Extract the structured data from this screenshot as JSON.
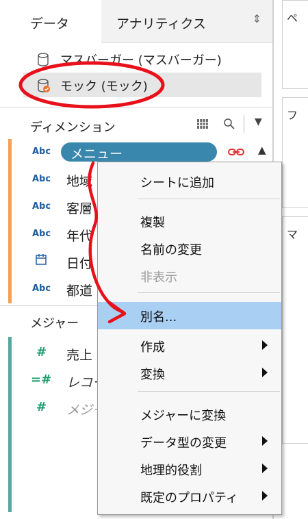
{
  "tabs": {
    "data_label": "データ",
    "analytics_label": "アナリティクス",
    "analytics_toggle": "⇕"
  },
  "sources": [
    {
      "name": "マスバーガー (マスバーガー)"
    },
    {
      "name": "モック (モック)"
    }
  ],
  "dimensions": {
    "header": "ディメンション",
    "fields": [
      {
        "type": "Abc",
        "name": "メニュー"
      },
      {
        "type": "Abc",
        "name": "地域"
      },
      {
        "type": "Abc",
        "name": "客層"
      },
      {
        "type": "Abc",
        "name": "年代"
      },
      {
        "type": "calendar-icon",
        "name": "日付"
      },
      {
        "type": "Abc",
        "name": "都道"
      }
    ]
  },
  "measures": {
    "header": "メジャー",
    "fields": [
      {
        "type": "#",
        "name": "売上"
      },
      {
        "type": "=#",
        "name": "レコー"
      },
      {
        "type": "#",
        "name": "メジャ"
      }
    ]
  },
  "right_panels": {
    "p1": "ペ",
    "p2": "フ",
    "p3": "マ"
  },
  "menu": {
    "add_to_sheet": "シートに追加",
    "duplicate": "複製",
    "rename": "名前の変更",
    "hide": "非表示",
    "aliases": "別名...",
    "create": "作成",
    "transform": "変換",
    "convert_to_measure": "メジャーに変換",
    "change_data_type": "データ型の変更",
    "geographic_role": "地理的役割",
    "default_properties": "既定のプロパティ"
  },
  "colors": {
    "selected_pill": "#3a87ad",
    "menu_highlight": "#a9cff2",
    "annotation_red": "#e8101a",
    "dimension_accent": "#f5a05a",
    "dimension_type": "#1f5fa3",
    "measure_type": "#1b9e6e"
  }
}
